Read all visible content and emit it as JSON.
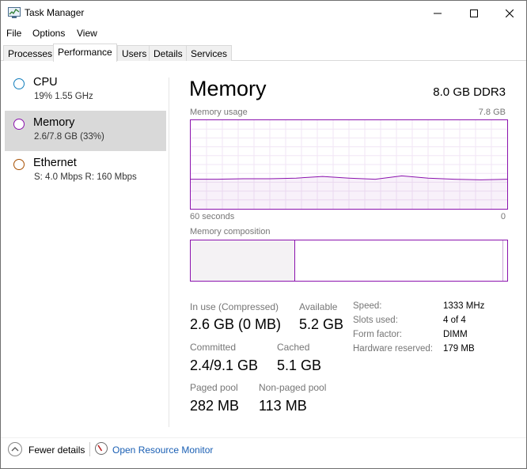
{
  "window": {
    "title": "Task Manager",
    "minimize_glyph": "—",
    "maximize_glyph": "☐",
    "close_glyph": "✕"
  },
  "menu": {
    "file": "File",
    "options": "Options",
    "view": "View"
  },
  "tabs": [
    "Processes",
    "Performance",
    "Users",
    "Details",
    "Services"
  ],
  "active_tab": "Performance",
  "sidebar": {
    "items": [
      {
        "title": "CPU",
        "subtitle": "19%  1.55 GHz",
        "circle_color": "#117dbb"
      },
      {
        "title": "Memory",
        "subtitle": "2.6/7.8 GB (33%)",
        "circle_color": "#8b12ae"
      },
      {
        "title": "Ethernet",
        "subtitle": "S: 4.0 Mbps  R: 160 Mbps",
        "circle_color": "#a74f01"
      }
    ],
    "selected": "Memory"
  },
  "panel": {
    "title": "Memory",
    "type": "8.0 GB DDR3",
    "usage_label": "Memory usage",
    "usage_max": "7.8 GB",
    "time_left": "60 seconds",
    "time_right": "0",
    "composition_label": "Memory composition",
    "composition_in_use_fraction": 0.33,
    "accent": "#8b12ae"
  },
  "chart_data": {
    "type": "area",
    "title": "Memory usage",
    "y_unit": "GB",
    "ylim": [
      0,
      7.8
    ],
    "x": [
      60,
      55,
      50,
      45,
      40,
      35,
      30,
      25,
      20,
      15,
      10,
      5,
      0
    ],
    "series": [
      {
        "values": [
          2.6,
          2.6,
          2.65,
          2.65,
          2.7,
          2.85,
          2.7,
          2.6,
          2.9,
          2.7,
          2.6,
          2.55,
          2.6
        ]
      }
    ]
  },
  "stats": {
    "in_use_label": "In use (Compressed)",
    "in_use_value": "2.6 GB (0 MB)",
    "available_label": "Available",
    "available_value": "5.2 GB",
    "committed_label": "Committed",
    "committed_value": "2.4/9.1 GB",
    "cached_label": "Cached",
    "cached_value": "5.1 GB",
    "paged_label": "Paged pool",
    "paged_value": "282 MB",
    "nonpaged_label": "Non-paged pool",
    "nonpaged_value": "113 MB"
  },
  "properties": [
    {
      "label": "Speed:",
      "value": "1333 MHz"
    },
    {
      "label": "Slots used:",
      "value": "4 of 4"
    },
    {
      "label": "Form factor:",
      "value": "DIMM"
    },
    {
      "label": "Hardware reserved:",
      "value": "179 MB"
    }
  ],
  "footer": {
    "fewer_details": "Fewer details",
    "open_monitor": "Open Resource Monitor"
  }
}
